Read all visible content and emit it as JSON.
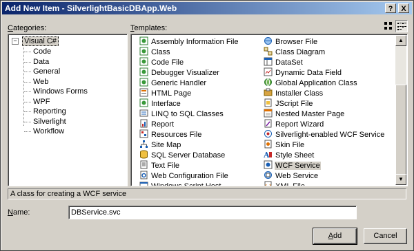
{
  "window": {
    "title": "Add New Item - SilverlightBasicDBApp.Web"
  },
  "titlebar_buttons": {
    "help": "?",
    "close": "X"
  },
  "categories": {
    "label": "Categories:",
    "root": "Visual C#",
    "root_expander": "−",
    "children": [
      "Code",
      "Data",
      "General",
      "Web",
      "Windows Forms",
      "WPF",
      "Reporting",
      "Silverlight",
      "Workflow"
    ]
  },
  "templates": {
    "label": "Templates:",
    "left_column": [
      {
        "label": "Assembly Information File",
        "icon": "cs-file-icon"
      },
      {
        "label": "Class",
        "icon": "cs-file-icon"
      },
      {
        "label": "Code File",
        "icon": "cs-file-icon"
      },
      {
        "label": "Debugger Visualizer",
        "icon": "cs-file-icon"
      },
      {
        "label": "Generic Handler",
        "icon": "cs-file-icon"
      },
      {
        "label": "HTML Page",
        "icon": "html-icon"
      },
      {
        "label": "Interface",
        "icon": "cs-file-icon"
      },
      {
        "label": "LINQ to SQL Classes",
        "icon": "linq-icon"
      },
      {
        "label": "Report",
        "icon": "report-icon"
      },
      {
        "label": "Resources File",
        "icon": "resources-icon"
      },
      {
        "label": "Site Map",
        "icon": "sitemap-icon"
      },
      {
        "label": "SQL Server Database",
        "icon": "database-icon"
      },
      {
        "label": "Text File",
        "icon": "text-file-icon"
      },
      {
        "label": "Web Configuration File",
        "icon": "config-icon"
      },
      {
        "label": "Windows Script Host",
        "icon": "script-icon"
      }
    ],
    "right_column": [
      {
        "label": "Browser File",
        "icon": "browser-icon"
      },
      {
        "label": "Class Diagram",
        "icon": "class-diagram-icon"
      },
      {
        "label": "DataSet",
        "icon": "dataset-icon"
      },
      {
        "label": "Dynamic Data Field",
        "icon": "dynamic-data-icon"
      },
      {
        "label": "Global Application Class",
        "icon": "global-icon"
      },
      {
        "label": "Installer Class",
        "icon": "installer-icon"
      },
      {
        "label": "JScript File",
        "icon": "jscript-icon"
      },
      {
        "label": "Nested Master Page",
        "icon": "master-page-icon"
      },
      {
        "label": "Report Wizard",
        "icon": "report-wizard-icon"
      },
      {
        "label": "Silverlight-enabled WCF Service",
        "icon": "wcf-icon"
      },
      {
        "label": "Skin File",
        "icon": "skin-icon"
      },
      {
        "label": "Style Sheet",
        "icon": "stylesheet-icon"
      },
      {
        "label": "WCF Service",
        "icon": "wcf-service-icon",
        "selected": true
      },
      {
        "label": "Web Service",
        "icon": "web-service-icon"
      },
      {
        "label": "XML File",
        "icon": "xml-icon"
      }
    ]
  },
  "description": "A class for creating a WCF service",
  "name": {
    "label": "Name:",
    "value": "DBService.svc"
  },
  "buttons": {
    "add": "Add",
    "cancel": "Cancel"
  },
  "colors": {
    "title_start": "#0a246a",
    "title_end": "#a6caf0",
    "face": "#d4d0c8"
  }
}
